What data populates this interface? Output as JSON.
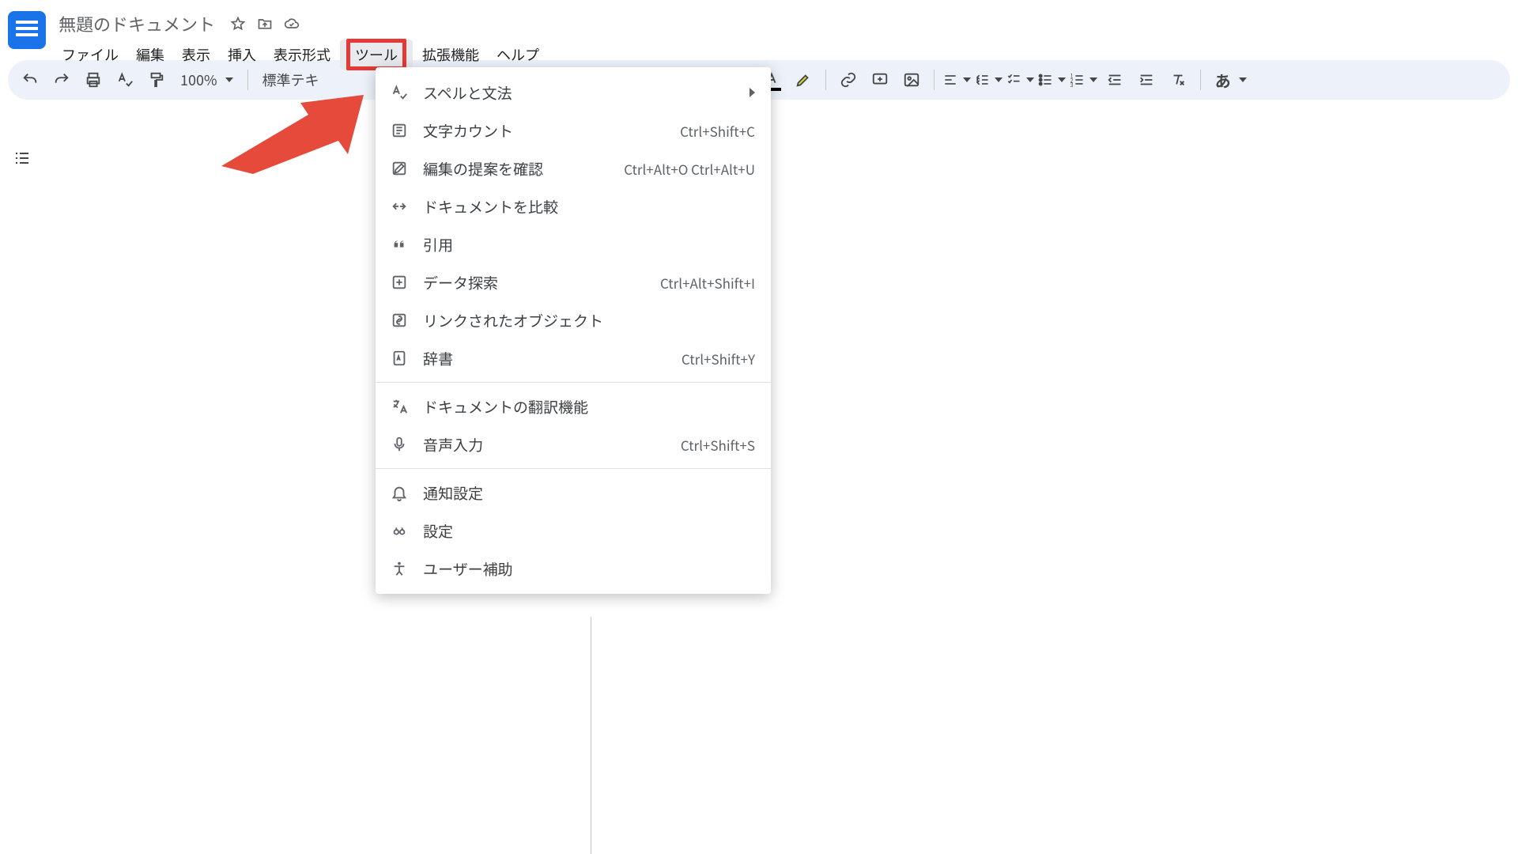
{
  "doc": {
    "title": "無題のドキュメント"
  },
  "menus": {
    "file": "ファイル",
    "edit": "編集",
    "view": "表示",
    "insert": "挿入",
    "format": "表示形式",
    "tools": "ツール",
    "extensions": "拡張機能",
    "help": "ヘルプ"
  },
  "toolbar": {
    "zoom": "100%",
    "styles": "標準テキ",
    "input_mode": "あ"
  },
  "tools_menu": {
    "spelling_grammar": {
      "label": "スペルと文法",
      "has_submenu": true
    },
    "word_count": {
      "label": "文字カウント",
      "shortcut": "Ctrl+Shift+C"
    },
    "review_suggestions": {
      "label": "編集の提案を確認",
      "shortcut": "Ctrl+Alt+O Ctrl+Alt+U"
    },
    "compare_docs": {
      "label": "ドキュメントを比較"
    },
    "citation": {
      "label": "引用"
    },
    "explore": {
      "label": "データ探索",
      "shortcut": "Ctrl+Alt+Shift+I"
    },
    "linked_objects": {
      "label": "リンクされたオブジェクト"
    },
    "dictionary": {
      "label": "辞書",
      "shortcut": "Ctrl+Shift+Y"
    },
    "translate_doc": {
      "label": "ドキュメントの翻訳機能"
    },
    "voice_typing": {
      "label": "音声入力",
      "shortcut": "Ctrl+Shift+S"
    },
    "notification_settings": {
      "label": "通知設定"
    },
    "preferences": {
      "label": "設定"
    },
    "accessibility": {
      "label": "ユーザー補助"
    }
  }
}
